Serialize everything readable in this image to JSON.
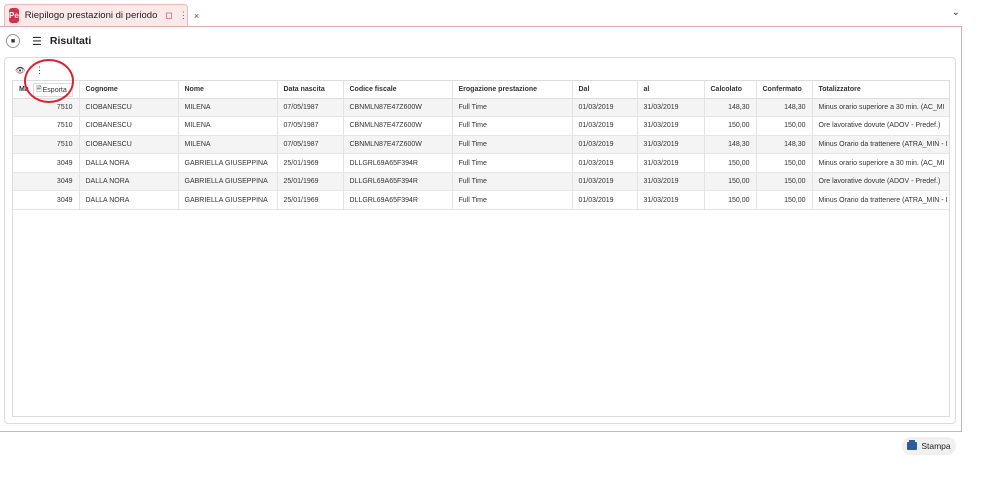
{
  "tab": {
    "logo": "Pe",
    "title": "Riepilogo prestazioni di periodo",
    "pin_icon": "bookmark-icon",
    "more_icon": "more-vert-icon",
    "close": "×"
  },
  "header": {
    "title": "Risultati"
  },
  "toolbar": {
    "eye_icon": "eye-icon",
    "more_icon": "more-vert-icon"
  },
  "dropdown": {
    "export_label": "Esporta"
  },
  "table": {
    "columns": [
      "Ma",
      "Cognome",
      "Nome",
      "Data nascita",
      "Codice fiscale",
      "Erogazione prestazione",
      "Dal",
      "al",
      "Calcolato",
      "Confermato",
      "Totalizzatore"
    ],
    "rows": [
      [
        "7510",
        "CIOBANESCU",
        "MILENA",
        "07/05/1987",
        "CBNMLN87E47Z600W",
        "Full Time",
        "01/03/2019",
        "31/03/2019",
        "148,30",
        "148,30",
        "Minus orario superiore a 30 min. (AC_MI"
      ],
      [
        "7510",
        "CIOBANESCU",
        "MILENA",
        "07/05/1987",
        "CBNMLN87E47Z600W",
        "Full Time",
        "01/03/2019",
        "31/03/2019",
        "150,00",
        "150,00",
        "Ore lavorative dovute (ADOV - Predef.)"
      ],
      [
        "7510",
        "CIOBANESCU",
        "MILENA",
        "07/05/1987",
        "CBNMLN87E47Z600W",
        "Full Time",
        "01/03/2019",
        "31/03/2019",
        "148,30",
        "148,30",
        "Minus Orario da trattenere (ATRA_MIN - I"
      ],
      [
        "3049",
        "DALLA NORA",
        "GABRIELLA GIUSEPPINA",
        "25/01/1969",
        "DLLGRL69A65F394R",
        "Full Time",
        "01/03/2019",
        "31/03/2019",
        "150,00",
        "150,00",
        "Minus orario superiore a 30 min. (AC_MI"
      ],
      [
        "3049",
        "DALLA NORA",
        "GABRIELLA GIUSEPPINA",
        "25/01/1969",
        "DLLGRL69A65F394R",
        "Full Time",
        "01/03/2019",
        "31/03/2019",
        "150,00",
        "150,00",
        "Ore lavorative dovute (ADOV - Predef.)"
      ],
      [
        "3049",
        "DALLA NORA",
        "GABRIELLA GIUSEPPINA",
        "25/01/1969",
        "DLLGRL69A65F394R",
        "Full Time",
        "01/03/2019",
        "31/03/2019",
        "150,00",
        "150,00",
        "Minus Orario da trattenere (ATRA_MIN - I"
      ]
    ]
  },
  "footer": {
    "print_label": "Stampa"
  },
  "colors": {
    "accent": "#d0344a",
    "frame": "#e7a8ae",
    "print_icon": "#2c5d9a"
  }
}
